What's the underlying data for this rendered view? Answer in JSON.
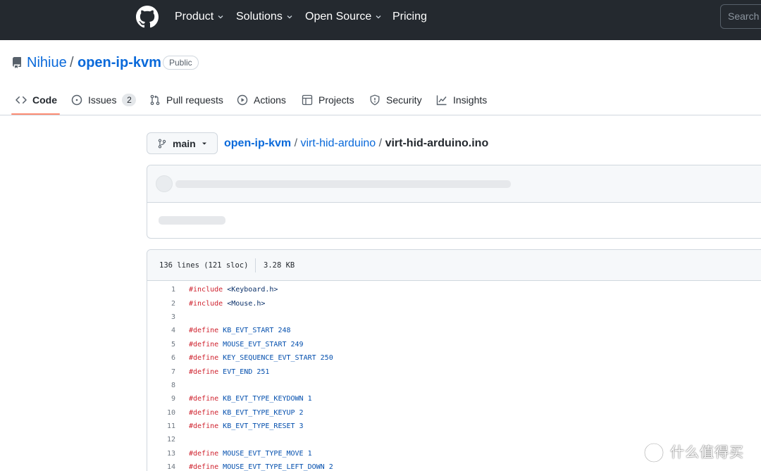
{
  "header": {
    "nav": [
      {
        "label": "Product",
        "has_chevron": true
      },
      {
        "label": "Solutions",
        "has_chevron": true
      },
      {
        "label": "Open Source",
        "has_chevron": true
      },
      {
        "label": "Pricing",
        "has_chevron": false
      }
    ],
    "search_placeholder": "Search",
    "colors": {
      "background": "#24292f"
    }
  },
  "repo": {
    "owner": "Nihiue",
    "separator": "/",
    "name": "open-ip-kvm",
    "visibility": "Public"
  },
  "tabs": [
    {
      "label": "Code",
      "icon": "code-icon",
      "selected": true
    },
    {
      "label": "Issues",
      "icon": "issue-icon",
      "count": "2"
    },
    {
      "label": "Pull requests",
      "icon": "pull-request-icon"
    },
    {
      "label": "Actions",
      "icon": "play-icon"
    },
    {
      "label": "Projects",
      "icon": "table-icon"
    },
    {
      "label": "Security",
      "icon": "shield-icon"
    },
    {
      "label": "Insights",
      "icon": "graph-icon"
    }
  ],
  "branch": {
    "label": "main",
    "icon": "git-branch-icon"
  },
  "breadcrumb": {
    "root": "open-ip-kvm",
    "dir": "virt-hid-arduino",
    "file": "virt-hid-arduino.ino",
    "sep": "/"
  },
  "file_info": {
    "lines": "136 lines (121 sloc)",
    "size": "3.28 KB"
  },
  "code": [
    {
      "n": "1",
      "parts": [
        [
          "kw",
          "#include"
        ],
        [
          "inc",
          " <Keyboard.h>"
        ]
      ]
    },
    {
      "n": "2",
      "parts": [
        [
          "kw",
          "#include"
        ],
        [
          "inc",
          " <Mouse.h>"
        ]
      ]
    },
    {
      "n": "3",
      "parts": []
    },
    {
      "n": "4",
      "parts": [
        [
          "kw",
          "#define"
        ],
        [
          "mac",
          " KB_EVT_START"
        ],
        [
          "num",
          " 248"
        ]
      ]
    },
    {
      "n": "5",
      "parts": [
        [
          "kw",
          "#define"
        ],
        [
          "mac",
          " MOUSE_EVT_START"
        ],
        [
          "num",
          " 249"
        ]
      ]
    },
    {
      "n": "6",
      "parts": [
        [
          "kw",
          "#define"
        ],
        [
          "mac",
          " KEY_SEQUENCE_EVT_START"
        ],
        [
          "num",
          " 250"
        ]
      ]
    },
    {
      "n": "7",
      "parts": [
        [
          "kw",
          "#define"
        ],
        [
          "mac",
          " EVT_END"
        ],
        [
          "num",
          " 251"
        ]
      ]
    },
    {
      "n": "8",
      "parts": []
    },
    {
      "n": "9",
      "parts": [
        [
          "kw",
          "#define"
        ],
        [
          "mac",
          " KB_EVT_TYPE_KEYDOWN"
        ],
        [
          "num",
          " 1"
        ]
      ]
    },
    {
      "n": "10",
      "parts": [
        [
          "kw",
          "#define"
        ],
        [
          "mac",
          " KB_EVT_TYPE_KEYUP"
        ],
        [
          "num",
          " 2"
        ]
      ]
    },
    {
      "n": "11",
      "parts": [
        [
          "kw",
          "#define"
        ],
        [
          "mac",
          " KB_EVT_TYPE_RESET"
        ],
        [
          "num",
          " 3"
        ]
      ]
    },
    {
      "n": "12",
      "parts": []
    },
    {
      "n": "13",
      "parts": [
        [
          "kw",
          "#define"
        ],
        [
          "mac",
          " MOUSE_EVT_TYPE_MOVE"
        ],
        [
          "num",
          " 1"
        ]
      ]
    },
    {
      "n": "14",
      "parts": [
        [
          "kw",
          "#define"
        ],
        [
          "mac",
          " MOUSE_EVT_TYPE_LEFT_DOWN"
        ],
        [
          "num",
          " 2"
        ]
      ]
    }
  ],
  "watermark": {
    "text": "什么值得买",
    "icon": "zhi-logo-icon"
  }
}
